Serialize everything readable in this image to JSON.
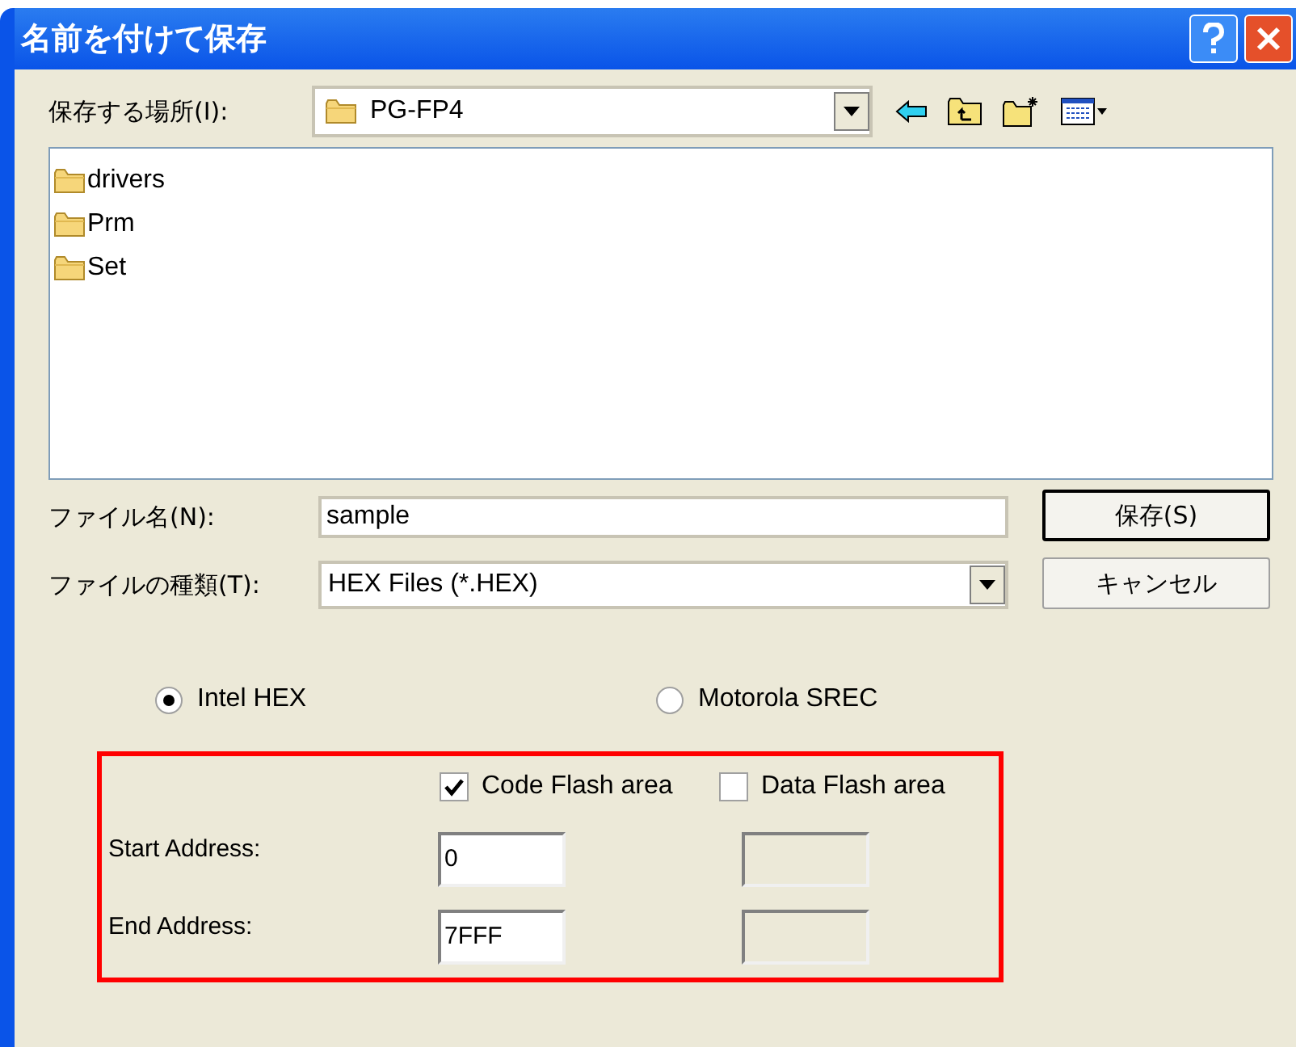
{
  "window": {
    "title": "名前を付けて保存"
  },
  "location": {
    "label": "保存する場所(I):",
    "value": "PG-FP4"
  },
  "files": [
    {
      "name": "drivers"
    },
    {
      "name": "Prm"
    },
    {
      "name": "Set"
    }
  ],
  "file_name": {
    "label": "ファイル名(N):",
    "value": "sample"
  },
  "file_type": {
    "label": "ファイルの種類(T):",
    "value": "HEX Files (*.HEX)"
  },
  "buttons": [
    {
      "label": "保存(S)",
      "default": true
    },
    {
      "label": "キャンセル",
      "default": false
    }
  ],
  "formats": [
    {
      "label": "Intel HEX",
      "selected": true
    },
    {
      "label": "Motorola SREC",
      "selected": false
    }
  ],
  "areas": [
    {
      "label": "Code Flash area",
      "checked": true,
      "start": "0",
      "end": "7FFF"
    },
    {
      "label": "Data Flash area",
      "checked": false
    }
  ],
  "address_labels": {
    "start": "Start Address:",
    "end": "End Address:"
  }
}
